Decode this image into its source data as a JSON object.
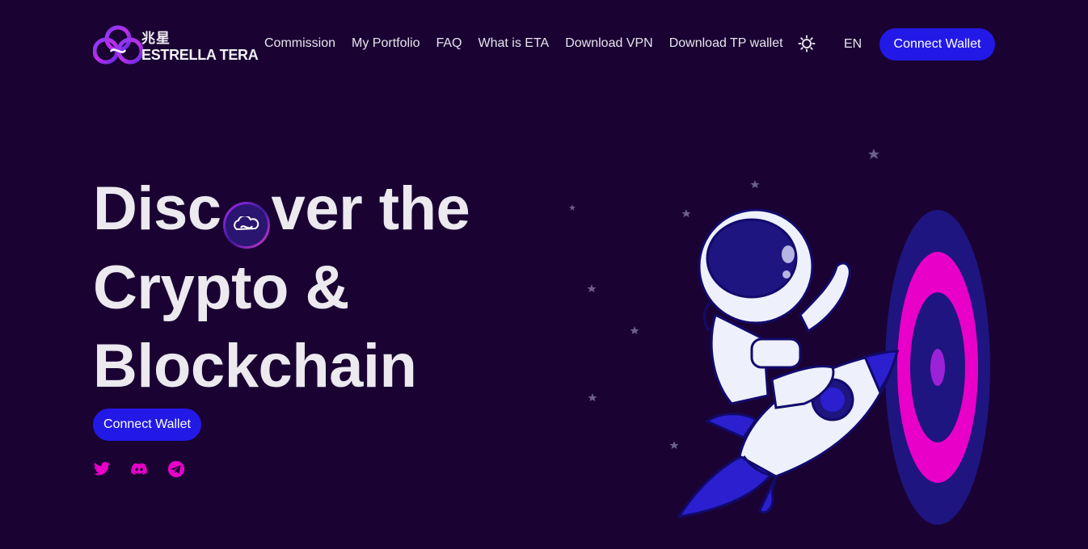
{
  "brand": {
    "name_cn": "兆星",
    "name_en": "ESTRELLA TERA",
    "logo_icon": "cloud-infinity-logo"
  },
  "nav": {
    "items": [
      {
        "label": "Commission"
      },
      {
        "label": "My Portfolio"
      },
      {
        "label": "FAQ"
      },
      {
        "label": "What is ETA"
      },
      {
        "label": "Download VPN"
      },
      {
        "label": "Download TP wallet"
      }
    ],
    "theme_icon": "sun-icon",
    "language": "EN",
    "connect_label": "Connect Wallet"
  },
  "hero": {
    "title_line1_a": "Disc",
    "title_line1_b": "ver the",
    "title_line2": "Crypto &",
    "title_line3": "Blockchain",
    "connect_label": "Connect Wallet"
  },
  "socials": [
    {
      "icon": "twitter-icon"
    },
    {
      "icon": "discord-icon"
    },
    {
      "icon": "telegram-icon"
    }
  ],
  "colors": {
    "background": "#1a0333",
    "primary_button": "#2319e6",
    "accent_pink": "#e800c8",
    "text": "#ece9ef"
  }
}
